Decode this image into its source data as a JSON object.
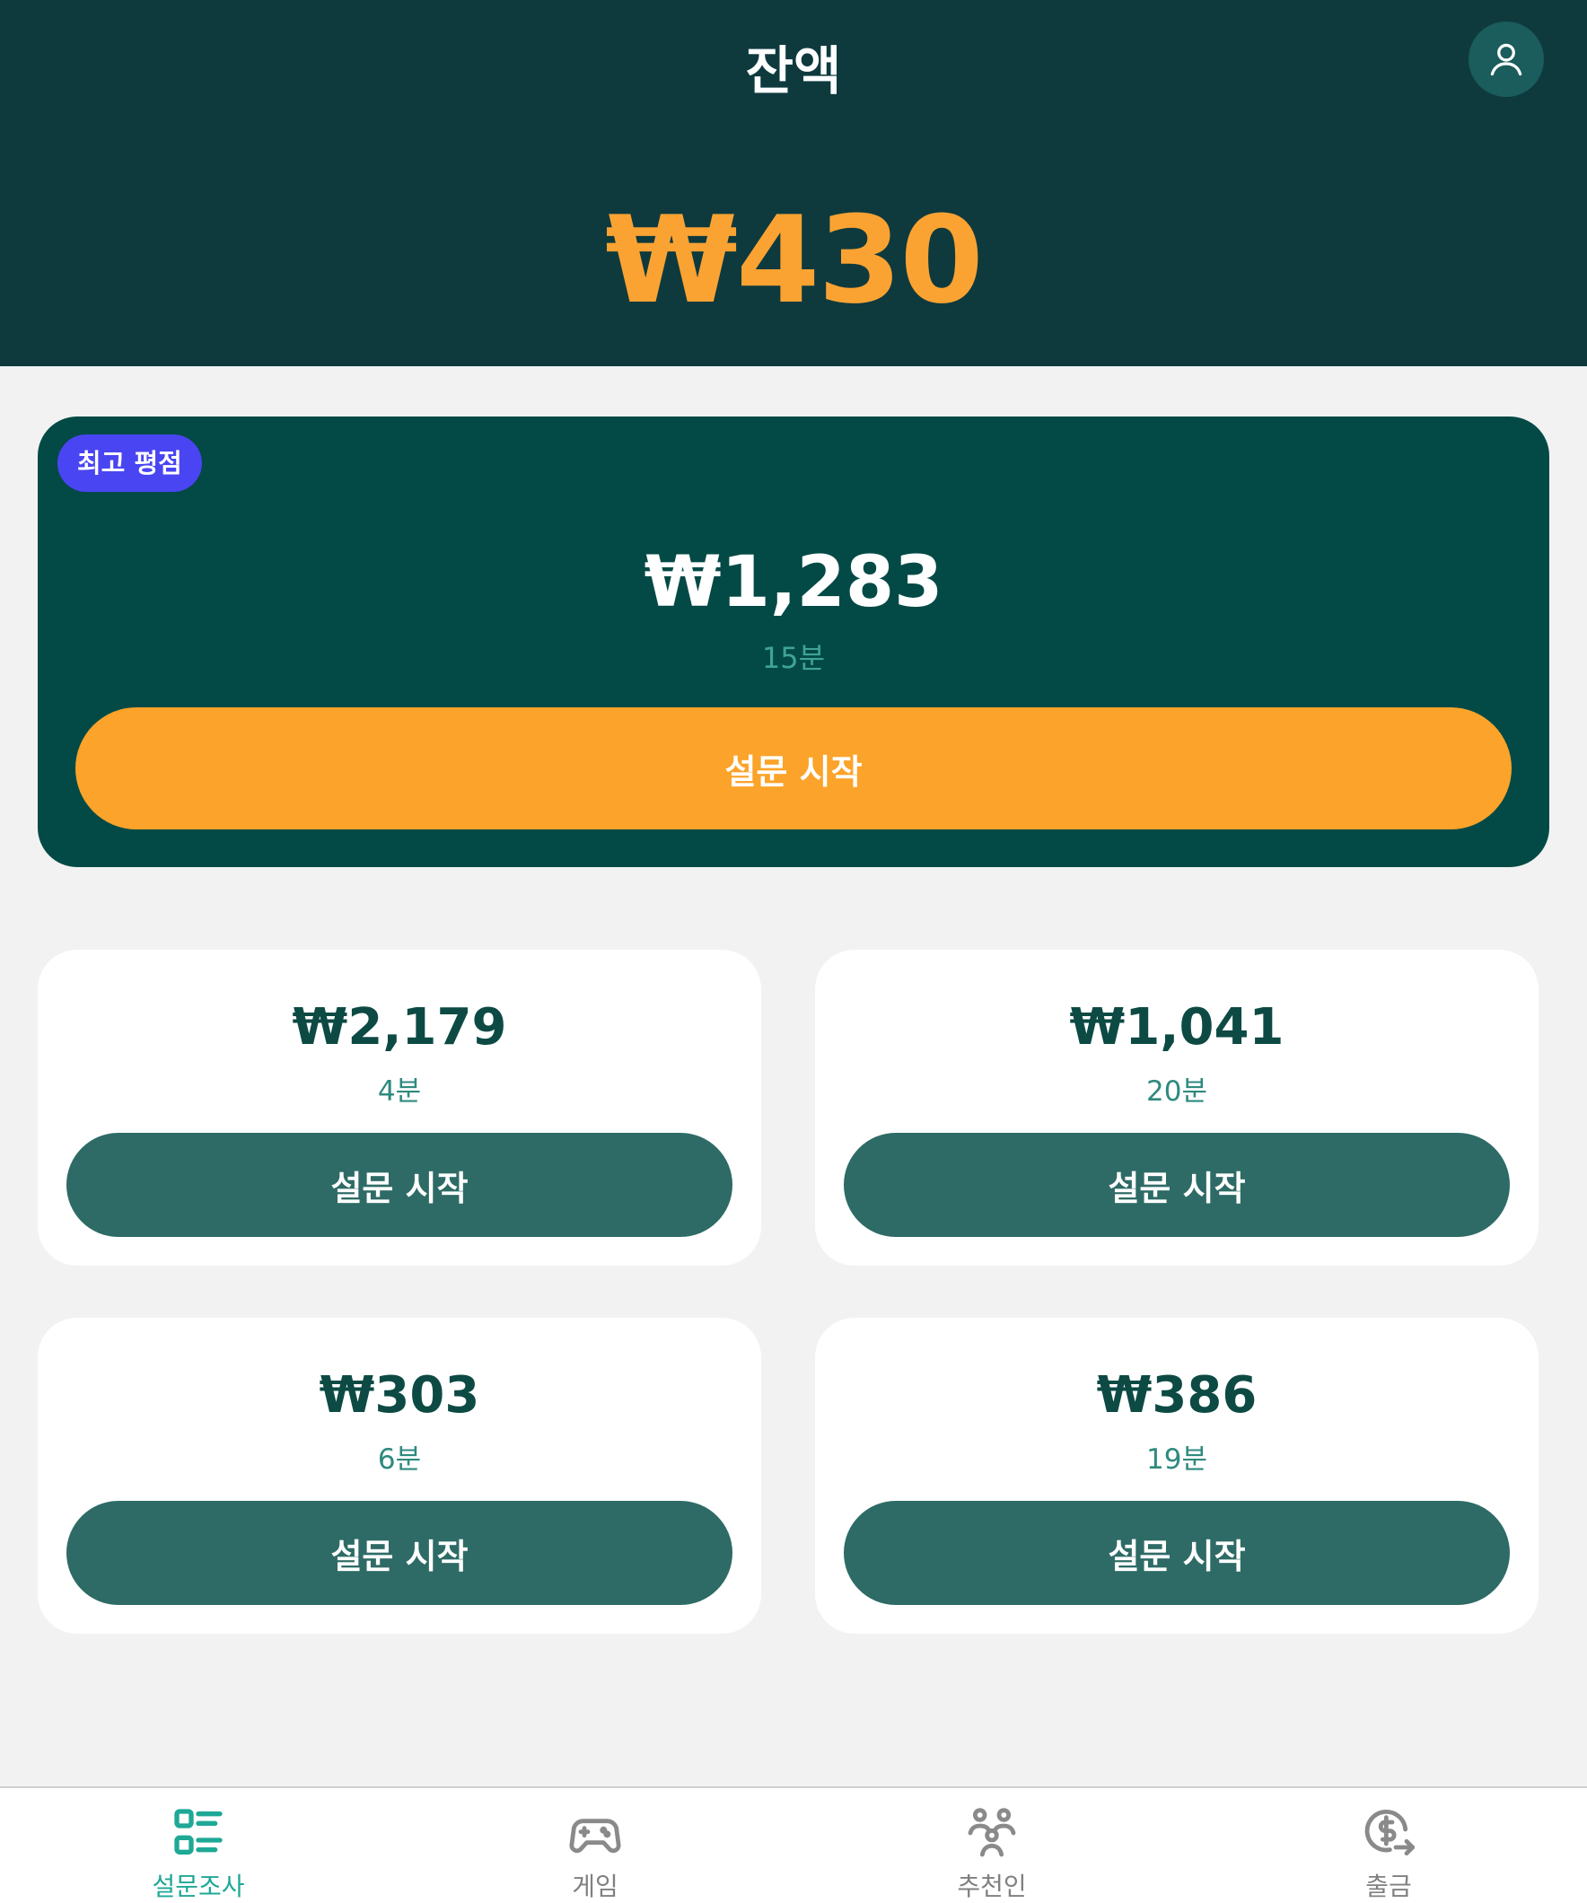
{
  "header": {
    "title": "잔액",
    "balance": "₩430"
  },
  "featured": {
    "badge": "최고 평점",
    "amount": "₩1,283",
    "time": "15분",
    "button_label": "설문 시작"
  },
  "surveys": [
    {
      "amount": "₩2,179",
      "time": "4분",
      "button_label": "설문 시작"
    },
    {
      "amount": "₩1,041",
      "time": "20분",
      "button_label": "설문 시작"
    },
    {
      "amount": "₩303",
      "time": "6분",
      "button_label": "설문 시작"
    },
    {
      "amount": "₩386",
      "time": "19분",
      "button_label": "설문 시작"
    }
  ],
  "nav": {
    "items": [
      {
        "label": "설문조사",
        "icon": "survey-list-icon",
        "active": true
      },
      {
        "label": "게임",
        "icon": "gamepad-icon",
        "active": false
      },
      {
        "label": "추천인",
        "icon": "referral-people-icon",
        "active": false
      },
      {
        "label": "출금",
        "icon": "withdraw-dollar-icon",
        "active": false
      }
    ]
  },
  "colors": {
    "header_bg": "#0e3a3e",
    "balance": "#fba332",
    "featured_bg": "#034a46",
    "badge_bg": "#4a45f2",
    "primary_button": "#fba32a",
    "secondary_button": "#2e6b66",
    "active_nav": "#1ea896"
  }
}
